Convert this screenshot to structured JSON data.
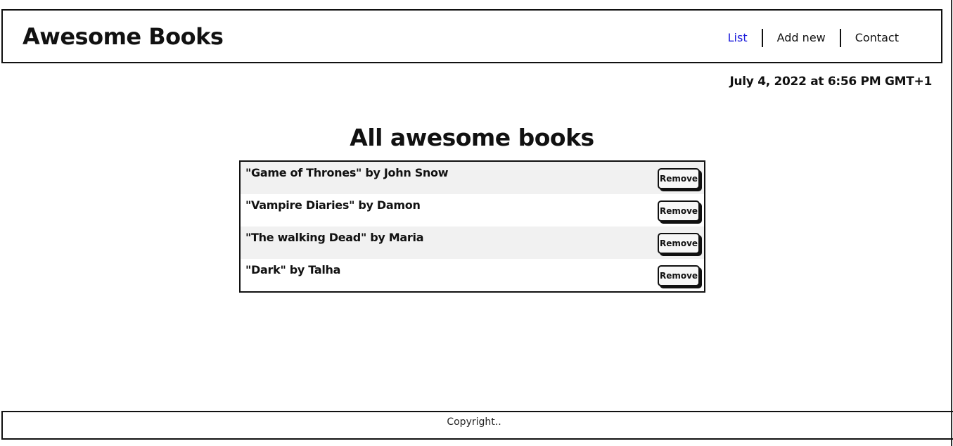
{
  "header": {
    "brand": "Awesome Books",
    "nav": [
      {
        "label": "List",
        "active": true
      },
      {
        "label": "Add new",
        "active": false
      },
      {
        "label": "Contact",
        "active": false
      }
    ]
  },
  "date": "July 4, 2022 at 6:56 PM GMT+1",
  "main": {
    "title": "All awesome books",
    "books": [
      {
        "text": "\"Game of Thrones\" by John Snow",
        "button": "Remove"
      },
      {
        "text": "\"Vampire Diaries\" by Damon",
        "button": "Remove"
      },
      {
        "text": "\"The walking Dead\" by Maria",
        "button": "Remove"
      },
      {
        "text": "\"Dark\" by Talha",
        "button": "Remove"
      }
    ]
  },
  "footer": {
    "text": "Copyright.."
  },
  "colors": {
    "active_link": "#1a1adb",
    "border": "#111111",
    "row_alt": "#f1f1f1"
  }
}
